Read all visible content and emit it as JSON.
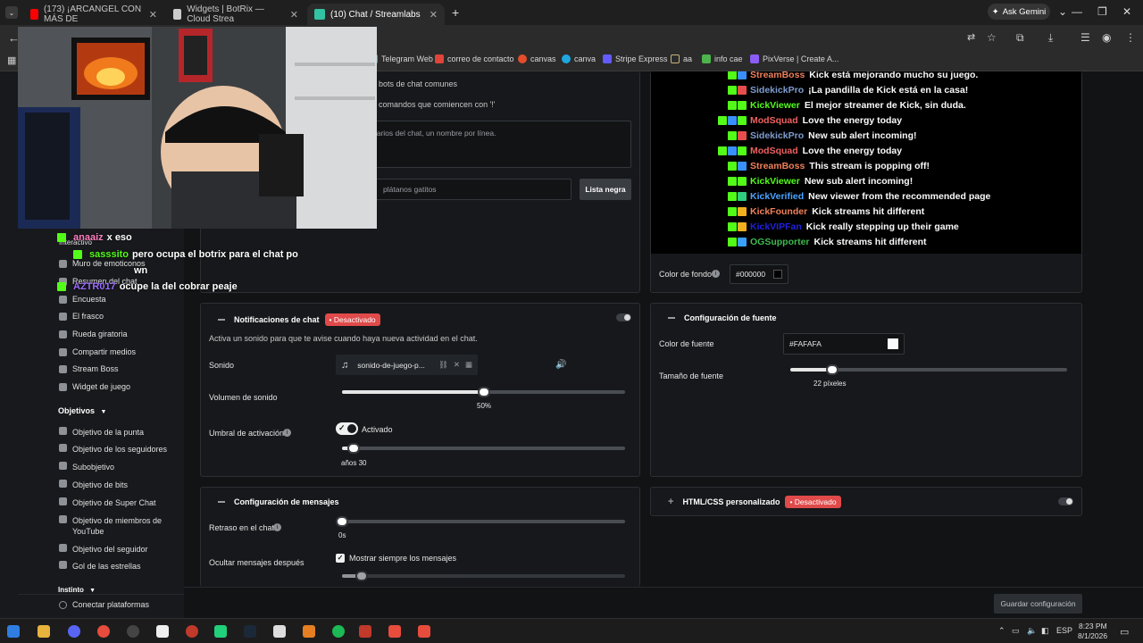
{
  "browser": {
    "tabs": [
      {
        "label": "(173) ¡ARCANGEL CON MÁS DE",
        "favicon_color": "#ff0000",
        "active": false
      },
      {
        "label": "Widgets | BotRix — Cloud Strea",
        "favicon_color": "#cccccc",
        "active": false
      },
      {
        "label": "(10) Chat / Streamlabs",
        "favicon_color": "#31c3a2",
        "active": true
      }
    ],
    "ask_gemini": "Ask Gemini",
    "bookmarks": [
      {
        "label": "Telegram Web",
        "color": "#2aa3e0"
      },
      {
        "label": "correo de contacto",
        "color": "#e0443a"
      },
      {
        "label": "canvas",
        "color": "#e34d2b"
      },
      {
        "label": "canva",
        "color": "#1fa7e0"
      },
      {
        "label": "Stripe Express",
        "color": "#635bff"
      },
      {
        "label": "aa",
        "color": "#c9b37a"
      },
      {
        "label": "info cae",
        "color": "#4db34d"
      },
      {
        "label": "PixVerse | Create A...",
        "color": "#8b5cf6"
      }
    ]
  },
  "sidebar": {
    "interactive_partial": "Interactivo",
    "items_top": [
      {
        "label": "Muro de emoticonos"
      },
      {
        "label": "Resumen del chat"
      },
      {
        "label": "Encuesta"
      },
      {
        "label": "El frasco"
      },
      {
        "label": "Rueda giratoria"
      },
      {
        "label": "Compartir medios"
      },
      {
        "label": "Stream Boss"
      },
      {
        "label": "Widget de juego"
      }
    ],
    "objetivos_heading": "Objetivos",
    "objetivos": [
      {
        "label": "Objetivo de la punta"
      },
      {
        "label": "Objetivo de los seguidores"
      },
      {
        "label": "Subobjetivo"
      },
      {
        "label": "Objetivo de bits"
      },
      {
        "label": "Objetivo de Super Chat"
      },
      {
        "label": "Objetivo de miembros de YouTube"
      },
      {
        "label": "Objetivo del seguidor"
      },
      {
        "label": "Gol de las estrellas"
      }
    ],
    "instinto_heading": "Instinto",
    "connect_label": "Conectar plataformas"
  },
  "filters": {
    "bots_label": "bots de chat comunes",
    "commands_label": "comandos que comiencen con '!'",
    "users_placeholder": "uarios del chat, un nombre por línea.",
    "blacklist_placeholder": "plátanos gatitos",
    "blacklist_button": "Lista negra"
  },
  "chat_preview": {
    "lines": [
      {
        "name": "StreamBoss",
        "color": "#f0805a",
        "text": "Kick está mejorando mucho su juego.",
        "badges": [
          "#53fc18",
          "#3a8fff"
        ]
      },
      {
        "name": "SidekickPro",
        "color": "#7f9ccf",
        "text": "¡La pandilla de Kick está en la casa!",
        "badges": [
          "#53fc18",
          "#e84d4d"
        ]
      },
      {
        "name": "KickViewer",
        "color": "#53fc18",
        "text": "El mejor streamer de Kick, sin duda.",
        "badges": [
          "#53fc18",
          "#53fc18"
        ]
      },
      {
        "name": "ModSquad",
        "color": "#f06060",
        "text": "Love the energy today",
        "badges": [
          "#53fc18",
          "#3a8fff",
          "#53fc18"
        ]
      },
      {
        "name": "SidekickPro",
        "color": "#7f9ccf",
        "text": "New sub alert incoming!",
        "badges": [
          "#53fc18",
          "#e84d4d"
        ]
      },
      {
        "name": "ModSquad",
        "color": "#f06060",
        "text": "Love the energy today",
        "badges": [
          "#53fc18",
          "#3a8fff",
          "#53fc18"
        ]
      },
      {
        "name": "StreamBoss",
        "color": "#f0805a",
        "text": "This stream is popping off!",
        "badges": [
          "#53fc18",
          "#3a8fff"
        ]
      },
      {
        "name": "KickViewer",
        "color": "#53fc18",
        "text": "New sub alert incoming!",
        "badges": [
          "#53fc18",
          "#53fc18"
        ]
      },
      {
        "name": "KickVerified",
        "color": "#4aa3ff",
        "text": "New viewer from the recommended page",
        "badges": [
          "#53fc18",
          "#2fcf7f"
        ]
      },
      {
        "name": "KickFounder",
        "color": "#f0805a",
        "text": "Kick streams hit different",
        "badges": [
          "#53fc18",
          "#f0b020"
        ]
      },
      {
        "name": "KickVIPFan",
        "color": "#2020e0",
        "text": "Kick really stepping up their game",
        "badges": [
          "#53fc18",
          "#f0b020"
        ]
      },
      {
        "name": "OGSupporter",
        "color": "#3fb950",
        "text": "Kick streams hit different",
        "badges": [
          "#53fc18",
          "#3aa0ff"
        ]
      }
    ]
  },
  "background": {
    "label": "Color de fondo",
    "value": "#000000",
    "swatch": "#000000"
  },
  "chat_sound": {
    "title": "Notificaciones de chat",
    "badge": "Desactivado",
    "description": "Activa un sonido para que te avise cuando haya nueva actividad en el chat.",
    "sound_label": "Sonido",
    "sound_file": "sonido-de-juego-p...",
    "volume_label": "Volumen de sonido",
    "volume_value": "50%",
    "volume_fraction": 0.5,
    "threshold_label": "Umbral de activación",
    "threshold_toggle": "Activado",
    "threshold_value": "años 30",
    "threshold_fraction": 0.04
  },
  "font_config": {
    "title": "Configuración de fuente",
    "color_label": "Color de fuente",
    "color_value": "#FAFAFA",
    "swatch": "#FAFAFA",
    "size_label": "Tamaño de fuente",
    "size_value": "22 píxeles",
    "size_fraction": 0.15
  },
  "message_config": {
    "title": "Configuración de mensajes",
    "delay_label": "Retraso en el chat",
    "delay_value": "0s",
    "delay_fraction": 0,
    "hide_label": "Ocultar mensajes después",
    "always_show": "Mostrar siempre los mensajes",
    "hide_fraction": 0.07
  },
  "custom_css": {
    "title": "HTML/CSS personalizado",
    "badge": "Desactivado"
  },
  "save_button": "Guardar configuración",
  "stream_overlay": {
    "lines": [
      {
        "name": "anaaiz",
        "color": "#ff7fbf",
        "text": "x eso"
      },
      {
        "name": "sasssito",
        "color": "#53fc18",
        "text": "pero ocupa el botrix para el chat po"
      },
      {
        "name": "",
        "color": "#ffffff",
        "text": "wn"
      },
      {
        "name": "AZTR017",
        "color": "#9b6bff",
        "text": "ocupe la del cobrar peaje"
      }
    ]
  },
  "taskbar": {
    "lang": "ESP",
    "time": "8:23 PM",
    "date": "8/1/2026"
  }
}
